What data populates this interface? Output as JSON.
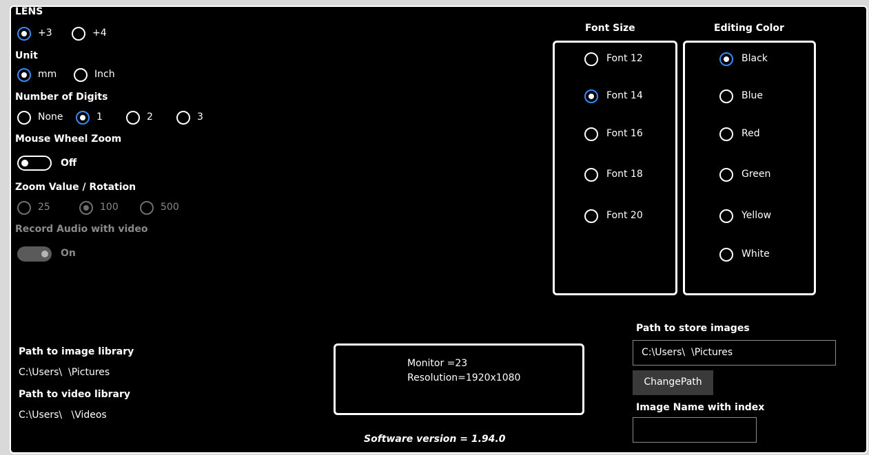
{
  "lens": {
    "title": "LENS",
    "options": [
      "+3",
      "+4"
    ],
    "selected": "+3"
  },
  "unit": {
    "title": "Unit",
    "options": [
      "mm",
      "Inch"
    ],
    "selected": "mm"
  },
  "digits": {
    "title": "Number of Digits",
    "options": [
      "None",
      "1",
      "2",
      "3"
    ],
    "selected": "1"
  },
  "mouse_wheel_zoom": {
    "title": "Mouse Wheel Zoom",
    "state_label": "Off"
  },
  "zoom_value": {
    "title": "Zoom Value / Rotation",
    "options": [
      "25",
      "100",
      "500"
    ],
    "selected": "100"
  },
  "record_audio": {
    "title": "Record Audio with video",
    "state_label": "On"
  },
  "font_size": {
    "title": "Font Size",
    "options": [
      "Font 12",
      "Font 14",
      "Font 16",
      "Font 18",
      "Font 20"
    ],
    "selected": "Font 14"
  },
  "editing_color": {
    "title": "Editing Color",
    "options": [
      "Black",
      "Blue",
      "Red",
      "Green",
      "Yellow",
      "White"
    ],
    "selected": "Black"
  },
  "image_library": {
    "title": "Path to image library",
    "path": "C:\\Users\\  \\Pictures"
  },
  "video_library": {
    "title": "Path to video library",
    "path": "C:\\Users\\   \\Videos"
  },
  "monitor_info": {
    "monitor": "Monitor =23",
    "resolution": "Resolution=1920x1080"
  },
  "software_version": "Software version = 1.94.0",
  "store_images": {
    "title": "Path to store images",
    "path": "C:\\Users\\  \\Pictures",
    "change_button": "ChangePath"
  },
  "image_name_index": {
    "title": "Image Name with index",
    "value": ""
  },
  "colors": {
    "accent": "#2f8cff",
    "background": "#000000",
    "disabled": "#8a8a8a",
    "button": "#3a3a3a"
  }
}
